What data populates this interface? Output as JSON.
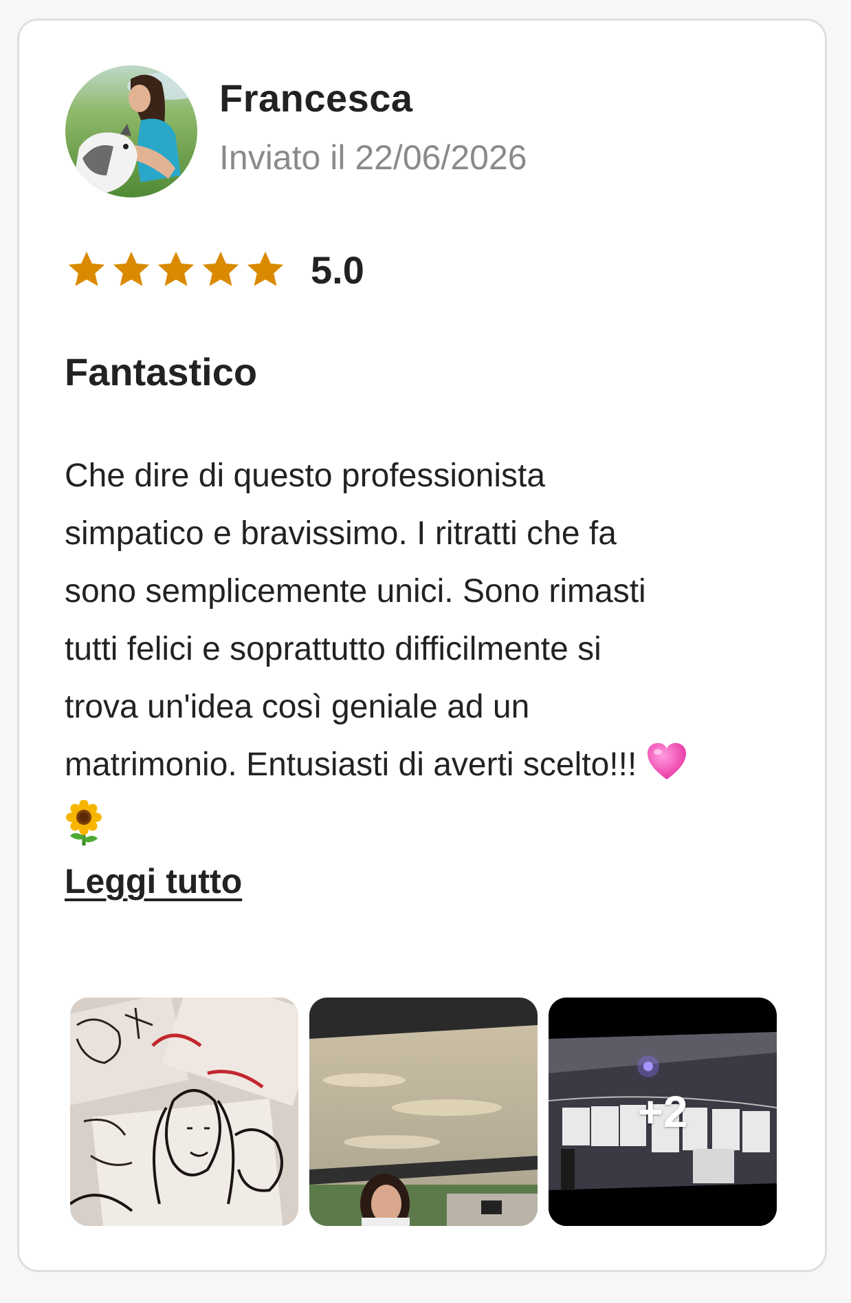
{
  "review": {
    "reviewer": {
      "name": "Francesca",
      "date": "Inviato il 22/06/2026"
    },
    "rating": {
      "value": "5.0",
      "stars": 5,
      "max_stars": 5,
      "star_color": "#d98a00"
    },
    "title": "Fantastico",
    "body_lines": [
      "Che dire di questo professionista",
      "simpatico e bravissimo. I ritratti che fa",
      "sono semplicemente unici. Sono rimasti",
      "tutti felici e soprattutto difficilmente si",
      "trova un'idea così geniale ad un",
      "matrimonio. Entusiasti di averti scelto!!!"
    ],
    "emojis": [
      "growing-heart-emoji",
      "sunflower-emoji"
    ],
    "read_more": "Leggi tutto",
    "photos": {
      "items": [
        "caricature-drawings-photo",
        "artist-under-tent-photo",
        "night-gallery-photo"
      ],
      "more_count": "+2"
    }
  }
}
